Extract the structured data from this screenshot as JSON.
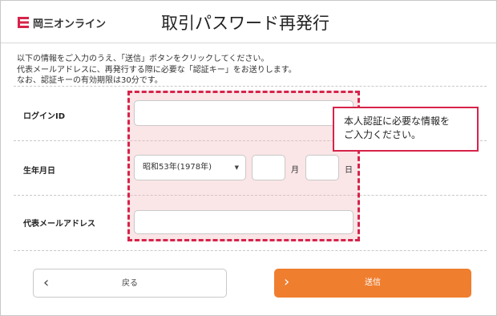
{
  "brand": {
    "name": "岡三オンライン",
    "logo_icon": "okasan-logo-icon",
    "logo_color": "#d6244a"
  },
  "page": {
    "title": "取引パスワード再発行"
  },
  "intro": {
    "line1": "以下の情報をご入力のうえ、「送信」ボタンをクリックしてください。",
    "line2": "代表メールアドレスに、再発行する際に必要な「認証キー」をお送りします。",
    "line3": "なお、認証キーの有効期限は30分です。"
  },
  "form": {
    "login_id": {
      "label": "ログインID",
      "value": ""
    },
    "birthdate": {
      "label": "生年月日",
      "year_selected": "昭和53年(1978年)",
      "month_value": "",
      "month_unit": "月",
      "day_value": "",
      "day_unit": "日"
    },
    "email": {
      "label": "代表メールアドレス",
      "value": ""
    }
  },
  "callout": {
    "line1": "本人認証に必要な情報を",
    "line2": "ご入力ください。"
  },
  "buttons": {
    "back_label": "戻る",
    "send_label": "送信"
  },
  "colors": {
    "accent": "#ef7e2f",
    "highlight_border": "#d6244a"
  }
}
